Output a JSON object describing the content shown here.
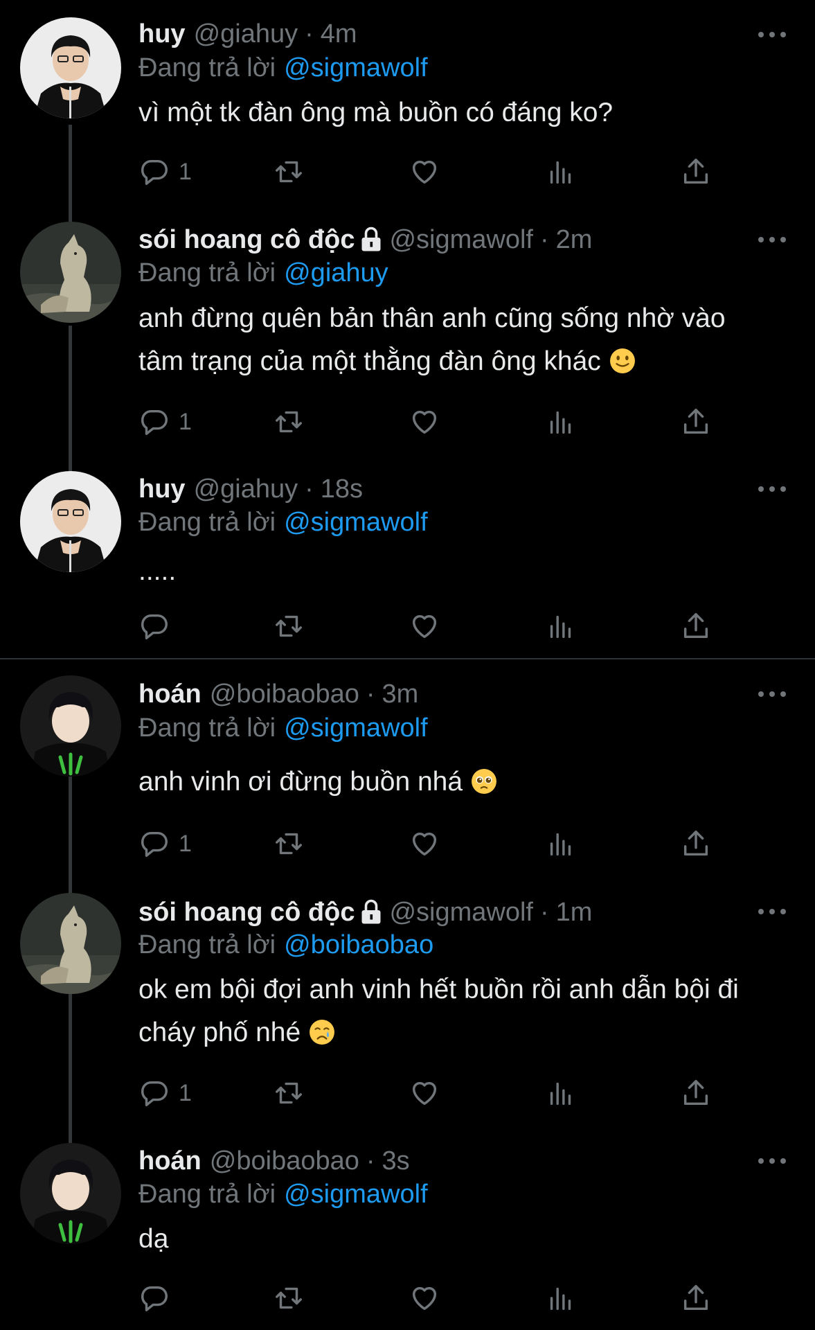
{
  "tweets": [
    {
      "name": "huy",
      "handle": "@giahuy",
      "time": "4m",
      "replying_label": "Đang trả lời",
      "replying_to": "@sigmawolf",
      "text": "vì một tk đàn ông mà buồn có đáng ko?",
      "reply_count": "1",
      "avatar": "avatar-huy",
      "locked": false,
      "emoji": ""
    },
    {
      "name": "sói hoang cô độc",
      "handle": "@sigmawolf",
      "time": "2m",
      "replying_label": "Đang trả lời",
      "replying_to": "@giahuy",
      "text_line1": "anh đừng quên bản thân anh cũng sống nhờ vào",
      "text_line2": "tâm trạng của một thằng đàn ông khác",
      "reply_count": "1",
      "avatar": "avatar-wolf",
      "locked": true,
      "emoji": "slightly-smiling-face"
    },
    {
      "name": "huy",
      "handle": "@giahuy",
      "time": "18s",
      "replying_label": "Đang trả lời",
      "replying_to": "@sigmawolf",
      "text": ".....",
      "reply_count": "",
      "avatar": "avatar-huy",
      "locked": false,
      "emoji": ""
    },
    {
      "name": "hoán",
      "handle": "@boibaobao",
      "time": "3m",
      "replying_label": "Đang trả lời",
      "replying_to": "@sigmawolf",
      "text": "anh vinh ơi đừng buồn nhá",
      "reply_count": "1",
      "avatar": "avatar-hoan",
      "locked": false,
      "emoji": "pleading-face"
    },
    {
      "name": "sói hoang cô độc",
      "handle": "@sigmawolf",
      "time": "1m",
      "replying_label": "Đang trả lời",
      "replying_to": "@boibaobao",
      "text_line1": "ok em bội đợi anh vinh hết buồn rồi anh dẫn bội đi",
      "text_line2": "cháy phố nhé",
      "reply_count": "1",
      "avatar": "avatar-wolf",
      "locked": true,
      "emoji": "crying-face"
    },
    {
      "name": "hoán",
      "handle": "@boibaobao",
      "time": "3s",
      "replying_label": "Đang trả lời",
      "replying_to": "@sigmawolf",
      "text": "dạ",
      "reply_count": "",
      "avatar": "avatar-hoan",
      "locked": false,
      "emoji": ""
    }
  ],
  "colors": {
    "background": "#000000",
    "text": "#e7e9ea",
    "secondary": "#71767b",
    "mention": "#1d9bf0",
    "thread_line": "#333639"
  },
  "separator_char": "·"
}
